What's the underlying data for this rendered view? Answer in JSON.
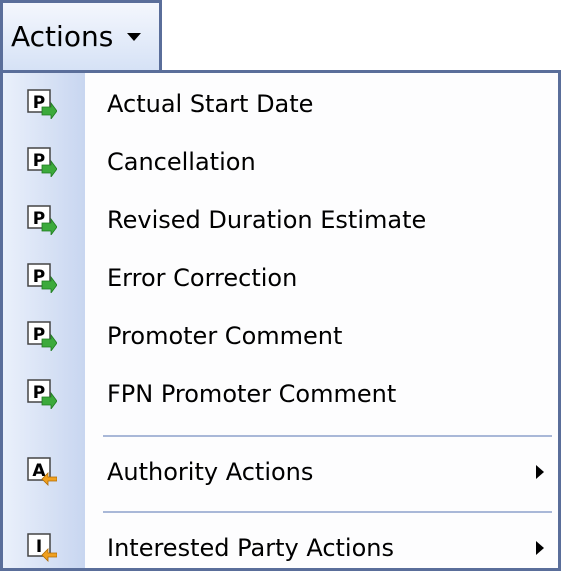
{
  "actions_menu": {
    "button_label": "Actions",
    "items": [
      {
        "label": "Actual Start Date",
        "icon": "P"
      },
      {
        "label": "Cancellation",
        "icon": "P"
      },
      {
        "label": "Revised Duration Estimate",
        "icon": "P"
      },
      {
        "label": "Error Correction",
        "icon": "P"
      },
      {
        "label": "Promoter Comment",
        "icon": "P"
      },
      {
        "label": "FPN Promoter Comment",
        "icon": "P"
      },
      {
        "label": "Authority Actions",
        "icon": "A"
      },
      {
        "label": "Interested Party Actions",
        "icon": "I"
      }
    ]
  },
  "colors": {
    "border": "#5a6e9a",
    "gutter": "#c8d6f0",
    "icon_green_arrow": "#3caa3c",
    "icon_orange_arrow": "#f0a020"
  },
  "icons": {
    "promoter_action": "promoter-action-icon",
    "authority_action": "authority-action-icon",
    "interested_party_action": "interested-party-action-icon"
  }
}
